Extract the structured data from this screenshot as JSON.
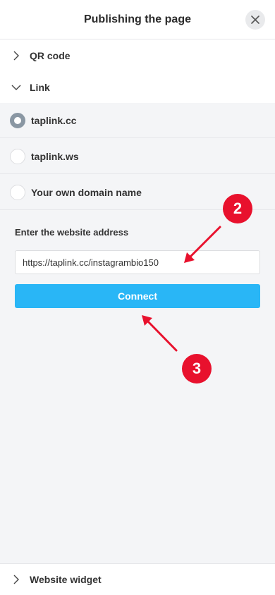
{
  "header": {
    "title": "Publishing the page",
    "close_icon": "close-icon"
  },
  "sections": {
    "qr_code": "QR code",
    "link": "Link",
    "website_widget": "Website widget"
  },
  "link_options": [
    {
      "label": "taplink.cc",
      "selected": true
    },
    {
      "label": "taplink.ws",
      "selected": false
    },
    {
      "label": "Your own domain name",
      "selected": false
    }
  ],
  "address": {
    "label": "Enter the website address",
    "value": "https://taplink.cc/instagrambio150"
  },
  "connect_label": "Connect",
  "annotations": {
    "marker_2": "2",
    "marker_3": "3",
    "color": "#e8112d"
  },
  "colors": {
    "accent": "#29b6f6",
    "radio_checked": "#8a97a3",
    "background": "#f4f5f7"
  }
}
